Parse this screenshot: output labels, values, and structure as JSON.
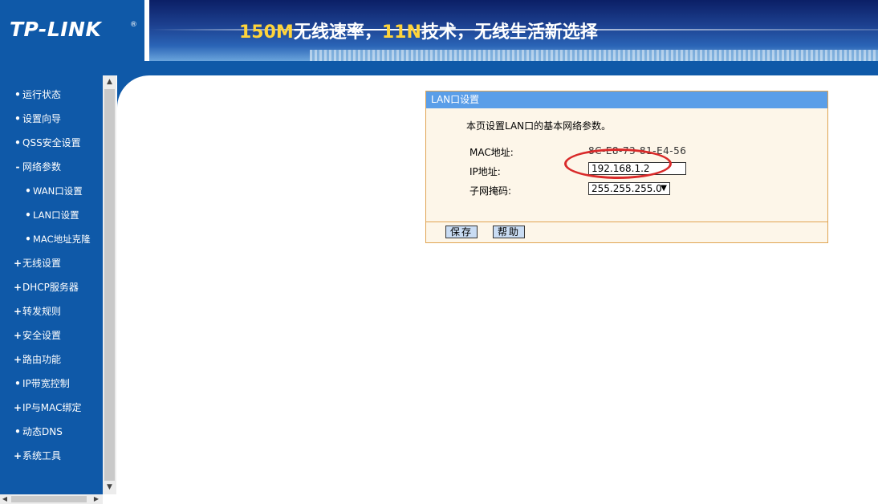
{
  "header": {
    "logo": "TP-LINK",
    "logo_reg": "®",
    "slogan_part1": "150M",
    "slogan_part2": "无线速率，",
    "slogan_part3": "11N",
    "slogan_part4": "技术，无线生活新选择"
  },
  "sidebar": {
    "items": [
      {
        "mark": "•",
        "label": "运行状态"
      },
      {
        "mark": "•",
        "label": "设置向导"
      },
      {
        "mark": "•",
        "label": "QSS安全设置"
      },
      {
        "mark": "-",
        "label": "网络参数"
      },
      {
        "mark": "•",
        "label": "WAN口设置"
      },
      {
        "mark": "•",
        "label": "LAN口设置"
      },
      {
        "mark": "•",
        "label": "MAC地址克隆"
      },
      {
        "mark": "+",
        "label": "无线设置"
      },
      {
        "mark": "+",
        "label": "DHCP服务器"
      },
      {
        "mark": "+",
        "label": "转发规则"
      },
      {
        "mark": "+",
        "label": "安全设置"
      },
      {
        "mark": "+",
        "label": "路由功能"
      },
      {
        "mark": "•",
        "label": "IP带宽控制"
      },
      {
        "mark": "+",
        "label": "IP与MAC绑定"
      },
      {
        "mark": "•",
        "label": "动态DNS"
      },
      {
        "mark": "+",
        "label": "系统工具"
      }
    ]
  },
  "scrollbar": {
    "up": "▲",
    "down": "▼",
    "left": "◀",
    "right": "▶"
  },
  "panel": {
    "title": "LAN口设置",
    "description": "本页设置LAN口的基本网络参数。",
    "mac_label": "MAC地址:",
    "mac_value": "8C-E8-73-81-E4-56",
    "ip_label": "IP地址:",
    "ip_value": "192.168.1.2",
    "mask_label": "子网掩码:",
    "mask_value": "255.255.255.0",
    "mask_arrow": "▼",
    "save_label": "保存",
    "help_label": "帮助"
  },
  "colors": {
    "brand_blue": "#0f59a8",
    "panel_title": "#5a9ee8",
    "panel_border": "#e0a452",
    "highlight_ring": "#d92a2a"
  }
}
